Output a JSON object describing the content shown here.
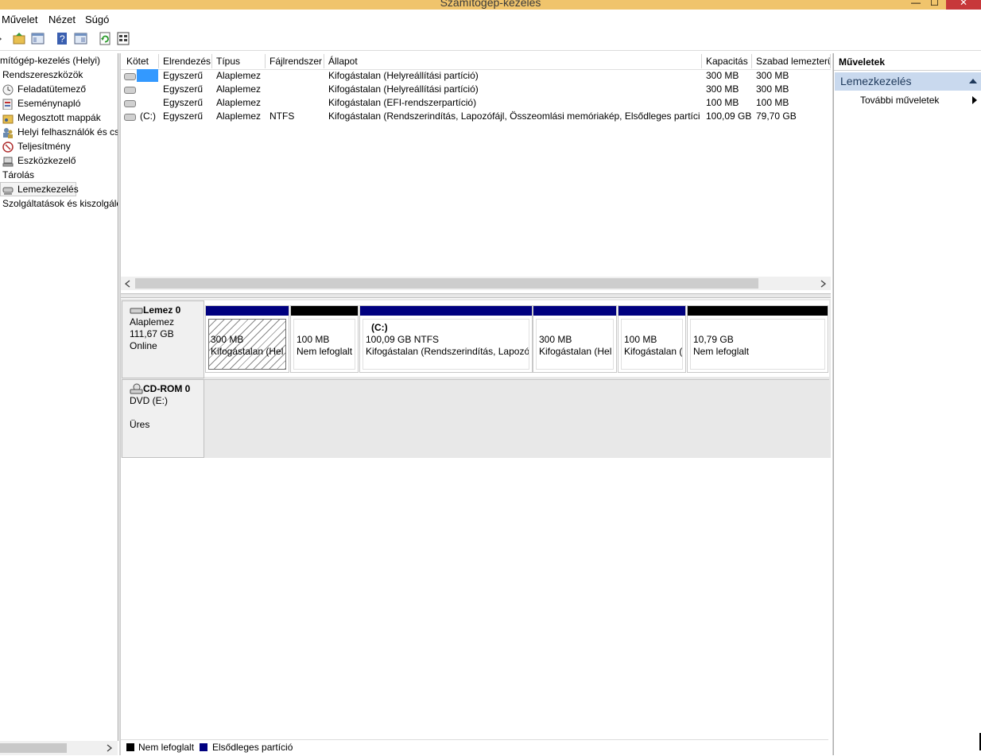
{
  "window": {
    "title": "Számítógép-kezelés",
    "close": "✕",
    "maximize": "☐",
    "minimize": "—"
  },
  "menu": {
    "muvelet": "Művelet",
    "nezet": "Nézet",
    "sugo": "Súgó"
  },
  "tree": {
    "root": "mítógép-kezelés (Helyi)",
    "tools": "Rendszereszközök",
    "task_scheduler": "Feladatütemező",
    "event_viewer": "Eseménynapló",
    "shared_folders": "Megosztott mappák",
    "local_users": "Helyi felhasználók és cs",
    "performance": "Teljesítmény",
    "device_manager": "Eszközkezelő",
    "storage": "Tárolás",
    "disk_management": "Lemezkezelés",
    "services": "Szolgáltatások és kiszolgáló"
  },
  "volume_table": {
    "columns": [
      "Kötet",
      "Elrendezés",
      "Típus",
      "Fájlrendszer",
      "Állapot",
      "Kapacitás",
      "Szabad lemezterü"
    ],
    "rows": [
      {
        "volume": "",
        "layout": "Egyszerű",
        "type": "Alaplemez",
        "fs": "",
        "status": "Kifogástalan (Helyreállítási partíció)",
        "capacity": "300 MB",
        "free": "300 MB"
      },
      {
        "volume": "",
        "layout": "Egyszerű",
        "type": "Alaplemez",
        "fs": "",
        "status": "Kifogástalan (Helyreállítási partíció)",
        "capacity": "300 MB",
        "free": "300 MB"
      },
      {
        "volume": "",
        "layout": "Egyszerű",
        "type": "Alaplemez",
        "fs": "",
        "status": "Kifogástalan (EFI-rendszerpartíció)",
        "capacity": "100 MB",
        "free": "100 MB"
      },
      {
        "volume": "(C:)",
        "layout": "Egyszerű",
        "type": "Alaplemez",
        "fs": "NTFS",
        "status": "Kifogástalan (Rendszerindítás, Lapozófájl, Összeomlási memóriakép, Elsődleges partíció)",
        "capacity": "100,09 GB",
        "free": "79,70 GB"
      }
    ]
  },
  "disk0": {
    "name": "Lemez 0",
    "type": "Alaplemez",
    "size": "111,67 GB",
    "status": "Online",
    "partitions": [
      {
        "label": "",
        "size": "300 MB",
        "status": "Kifogástalan (Hel",
        "bar": "#00007f"
      },
      {
        "label": "",
        "size": "100 MB",
        "status": "Nem lefoglalt",
        "bar": "#000000"
      },
      {
        "label": "(C:)",
        "size": "100,09 GB NTFS",
        "status": "Kifogástalan (Rendszerindítás, Lapozóf",
        "bar": "#00007f"
      },
      {
        "label": "",
        "size": "300 MB",
        "status": "Kifogástalan (Hel",
        "bar": "#00007f"
      },
      {
        "label": "",
        "size": "100 MB",
        "status": "Kifogástalan (",
        "bar": "#00007f"
      },
      {
        "label": "",
        "size": "10,79 GB",
        "status": "Nem lefoglalt",
        "bar": "#000000"
      }
    ]
  },
  "cdrom0": {
    "name": "CD-ROM 0",
    "type": "DVD (E:)",
    "status": "Üres"
  },
  "legend": {
    "unallocated": "Nem lefoglalt",
    "primary": "Elsődleges partíció"
  },
  "actions": {
    "header": "Műveletek",
    "section": "Lemezkezelés",
    "more": "További műveletek"
  },
  "colors": {
    "primary_partition": "#00007f",
    "unallocated": "#000000",
    "selection": "#3399ff"
  }
}
